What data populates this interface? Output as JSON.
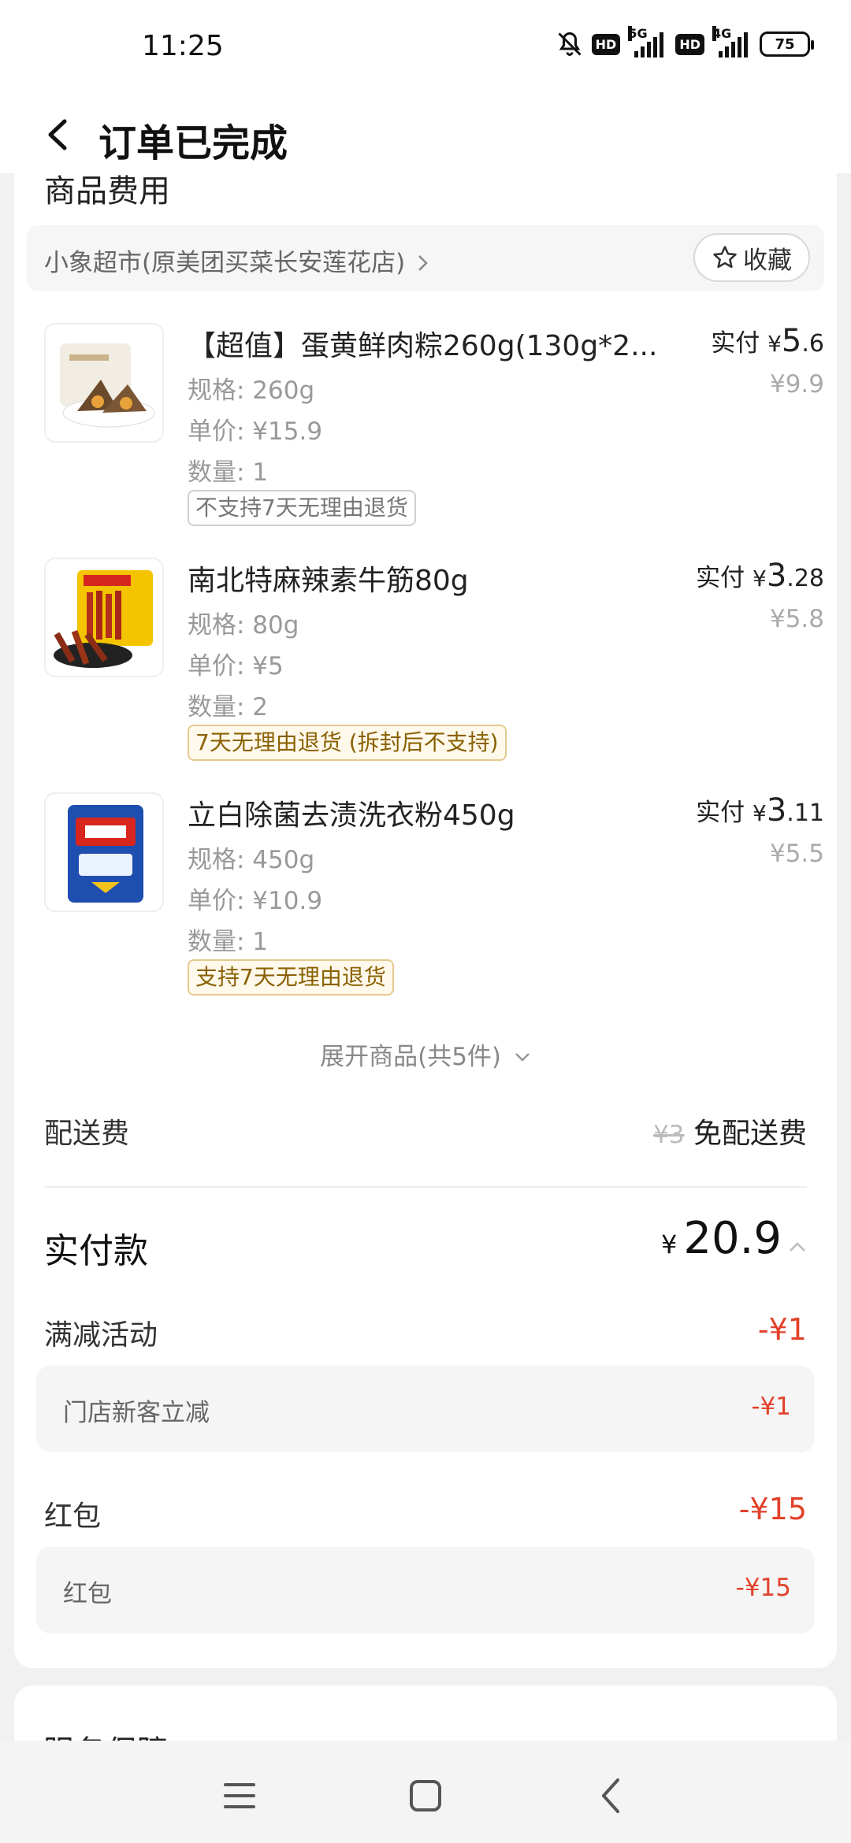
{
  "status": {
    "time": "11:25",
    "hd1": "HD",
    "net1": "5G",
    "hd2": "HD",
    "net2": "4G",
    "battery": "75"
  },
  "header": {
    "title": "订单已完成"
  },
  "fees_section": {
    "title": "商品费用",
    "store_name": "小象超市(原美团买菜长安莲花店)",
    "favorite_label": "收藏"
  },
  "items": [
    {
      "name": "【超值】蛋黄鲜肉粽260g(130g*2...",
      "paid_label": "实付",
      "paid_yen": "¥",
      "paid_int": "5",
      "paid_dec": ".6",
      "original_price": "¥9.9",
      "spec": "规格: 260g",
      "unit_price": "单价: ¥15.9",
      "quantity": "数量: 1",
      "tag": "不支持7天无理由退货"
    },
    {
      "name": "南北特麻辣素牛筋80g",
      "paid_label": "实付",
      "paid_yen": "¥",
      "paid_int": "3",
      "paid_dec": ".28",
      "original_price": "¥5.8",
      "spec": "规格: 80g",
      "unit_price": "单价: ¥5",
      "quantity": "数量: 2",
      "tag": "7天无理由退货 (拆封后不支持)"
    },
    {
      "name": "立白除菌去渍洗衣粉450g",
      "paid_label": "实付",
      "paid_yen": "¥",
      "paid_int": "3",
      "paid_dec": ".11",
      "original_price": "¥5.5",
      "spec": "规格: 450g",
      "unit_price": "单价: ¥10.9",
      "quantity": "数量: 1",
      "tag": "支持7天无理由退货"
    }
  ],
  "expand_label": "展开商品(共5件)",
  "delivery": {
    "label": "配送费",
    "original": "¥3",
    "value": "免配送费"
  },
  "total": {
    "label": "实付款",
    "yen": "¥",
    "amount": "20.9"
  },
  "discounts": {
    "manjian": {
      "label": "满减活动",
      "amount": "-¥1",
      "sub_label": "门店新客立减",
      "sub_amount": "-¥1"
    },
    "hongbao": {
      "label": "红包",
      "amount": "-¥15",
      "sub_label": "红包",
      "sub_amount": "-¥15"
    }
  },
  "service": {
    "title": "服务保障"
  },
  "colors": {
    "accent_red": "#e3412b",
    "tag_gold": "#8a6100"
  }
}
